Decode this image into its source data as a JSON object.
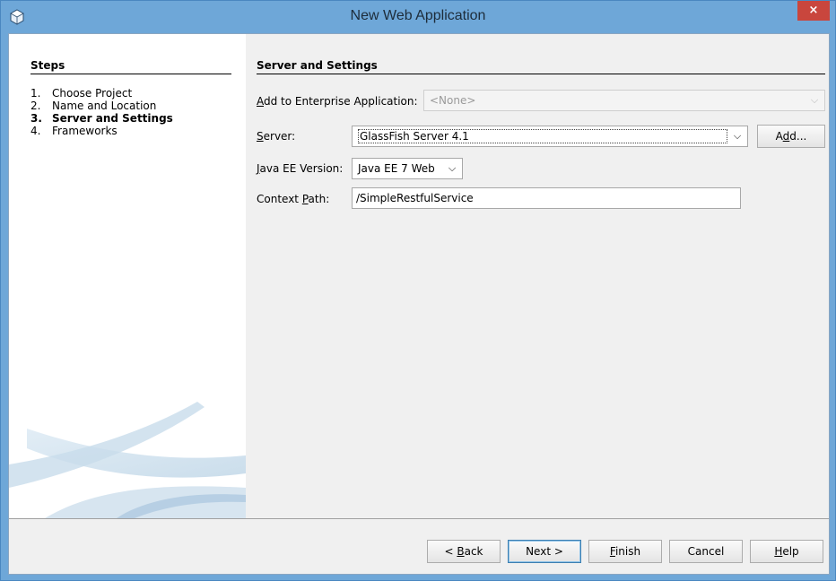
{
  "window": {
    "title": "New Web Application",
    "close_glyph": "×",
    "accent": "#6ea7d8",
    "close_color": "#c9463d"
  },
  "steps": {
    "heading": "Steps",
    "items": [
      {
        "num": "1.",
        "label": "Choose Project"
      },
      {
        "num": "2.",
        "label": "Name and Location"
      },
      {
        "num": "3.",
        "label": "Server and Settings"
      },
      {
        "num": "4.",
        "label": "Frameworks"
      }
    ],
    "current_index": 2
  },
  "main": {
    "heading": "Server and Settings",
    "enterprise": {
      "label_mn": "A",
      "label_rest": "dd to Enterprise Application:",
      "value": "<None>"
    },
    "server": {
      "label_mn": "S",
      "label_rest": "erver:",
      "value": "GlassFish Server 4.1",
      "add_pre": "A",
      "add_mn": "d",
      "add_post": "d..."
    },
    "javaee": {
      "label_mn": "J",
      "label_rest": "ava EE Version:",
      "value": "Java EE 7 Web"
    },
    "context": {
      "label_pre": "Context ",
      "label_mn": "P",
      "label_rest": "ath:",
      "value": "/SimpleRestfulService"
    }
  },
  "footer": {
    "back": {
      "pre": "< ",
      "mn": "B",
      "post": "ack"
    },
    "next": {
      "label": "Next >"
    },
    "finish": {
      "mn": "F",
      "post": "inish"
    },
    "cancel": {
      "label": "Cancel"
    },
    "help": {
      "mn": "H",
      "post": "elp"
    }
  }
}
